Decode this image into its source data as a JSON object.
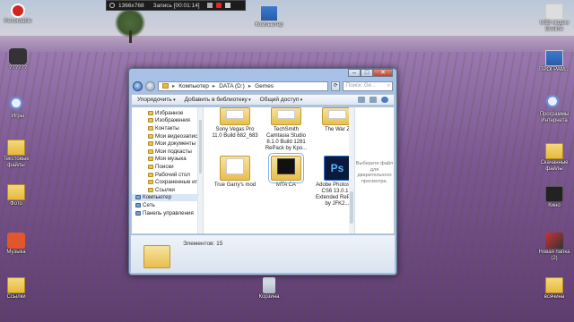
{
  "recorder": {
    "resolution": "1366x768",
    "status": "Запись [00:01:14]"
  },
  "desktop_icons": [
    {
      "key": "recording",
      "label": "Recordable",
      "icon": "record-icon"
    },
    {
      "key": "ppt",
      "label": "??????",
      "icon": "microphone-icon"
    },
    {
      "key": "games",
      "label": "Игры",
      "icon": "search-icon"
    },
    {
      "key": "text-files",
      "label": "Текстовые файлы",
      "icon": "folder-icon"
    },
    {
      "key": "photos",
      "label": "Фото",
      "icon": "folder-icon"
    },
    {
      "key": "music",
      "label": "Музыка",
      "icon": "power-icon"
    },
    {
      "key": "links",
      "label": "Ссылки",
      "icon": "folder-icon"
    },
    {
      "key": "computer",
      "label": "Компьютер",
      "icon": "computer-icon"
    },
    {
      "key": "usb",
      "label": "USB модем Beeline",
      "icon": "usb-icon"
    },
    {
      "key": "programs",
      "label": "ПРОГРАМ...",
      "icon": "monitor-icon"
    },
    {
      "key": "internet",
      "label": "Программы Интернета",
      "icon": "search-icon"
    },
    {
      "key": "downloads",
      "label": "Скачанные файлы",
      "icon": "folder-icon"
    },
    {
      "key": "cinema",
      "label": "Кино",
      "icon": "film-icon"
    },
    {
      "key": "new-folder",
      "label": "Новая папка (2)",
      "icon": "photo-icon"
    },
    {
      "key": "misc",
      "label": "всячина",
      "icon": "folder-icon"
    },
    {
      "key": "recycle",
      "label": "Корзина",
      "icon": "trash-icon"
    }
  ],
  "explorer": {
    "breadcrumb": [
      "Компьютер",
      "DATA (D:)",
      "Gemes"
    ],
    "search_placeholder": "Поиск: Ge...",
    "toolbar": {
      "organize": "Упорядочить",
      "add_to_library": "Добавить в библиотеку",
      "share": "Общий доступ"
    },
    "nav_items": [
      "Избранное",
      "Изображения",
      "Контакты",
      "Мои видеозаписи",
      "Мои документы",
      "Мои подкасты",
      "Моя музыка",
      "Поиски",
      "Рабочий стол",
      "Сохраненные игр",
      "Ссылки"
    ],
    "nav_computer": "Компьютер",
    "nav_network": "Сеть",
    "nav_control": "Панель управления",
    "files": [
      {
        "name": "Sony Vegas Pro 11.0 Build 682_683",
        "thumb": "folder"
      },
      {
        "name": "TechSmith Camtasia Studio 8.1.0 Build 1281 RePack by Kpo...",
        "thumb": "folder"
      },
      {
        "name": "The War Z",
        "thumb": "folder"
      },
      {
        "name": "True Garry's mod",
        "thumb": "folder"
      },
      {
        "name": "MTA CA",
        "thumb": "folder-dark"
      },
      {
        "name": "Adobe Photoshop CS6 13.0.1.3 Extended RePack by JFK2...",
        "thumb": "ps"
      }
    ],
    "preview_text": "Выберите файл для дварительного просмотра.",
    "item_count": "Элементов: 15"
  }
}
